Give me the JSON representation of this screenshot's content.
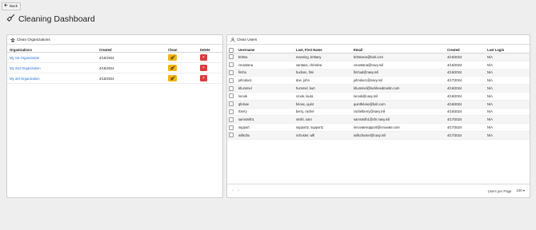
{
  "back_label": "Back",
  "title": "Cleaning Dashboard",
  "orgs_panel": {
    "title": "Clean Organizations",
    "headers": {
      "org": "Organizations",
      "created": "Created",
      "clean": "Clean",
      "delete": "Delete"
    },
    "rows": [
      {
        "name": "My 1st Organization",
        "created": "4/16/2024"
      },
      {
        "name": "My 2nd Organization",
        "created": "4/16/2024"
      },
      {
        "name": "My 3rd Organization",
        "created": "4/16/2024"
      }
    ],
    "delete_glyph": "×"
  },
  "users_panel": {
    "title": "Clean Users",
    "headers": {
      "username": "Username",
      "name": "Last, First Name",
      "email": "Email",
      "created": "Created",
      "last_login": "Last Login"
    },
    "rows": [
      {
        "username": "brittna",
        "name": "manning, brittany",
        "email": "brittmann@bah.com",
        "created": "4/16/2024",
        "last_login": "N/A"
      },
      {
        "username": "cmantana",
        "name": "santana, christina",
        "email": "cmantana@navy.mil",
        "created": "4/16/2024",
        "last_login": "N/A"
      },
      {
        "username": "fimhu",
        "name": "hudson, fimi",
        "email": "fimhud@navy.mil",
        "created": "4/16/2024",
        "last_login": "N/A"
      },
      {
        "username": "johndoe1",
        "name": "doe, john",
        "email": "johndoe1@navy.mil",
        "created": "4/17/2024",
        "last_login": "N/A"
      },
      {
        "username": "khummel",
        "name": "hummel, kurt",
        "email": "khummel@lockheedmartin.com",
        "created": "4/16/2024",
        "last_login": "N/A"
      },
      {
        "username": "lorook",
        "name": "crook, laura",
        "email": "lorook@navy.mil",
        "created": "4/16/2024",
        "last_login": "N/A"
      },
      {
        "username": "qfelose",
        "name": "felose, quint",
        "email": "quintfelose@bah.com",
        "created": "4/16/2024",
        "last_login": "N/A"
      },
      {
        "username": "rberry",
        "name": "berry, rachel",
        "email": "rachelberry@navy.mil",
        "created": "4/16/2024",
        "last_login": "N/A"
      },
      {
        "username": "samsmith1",
        "name": "smith, sam",
        "email": "samsmith1@chr.navy.mil",
        "created": "4/17/2024",
        "last_login": "N/A"
      },
      {
        "username": "support",
        "name": "support2, support1",
        "email": "innovatesupport@innovate.com",
        "created": "4/17/2024",
        "last_login": "N/A"
      },
      {
        "username": "willschu",
        "name": "schuster, will",
        "email": "willschuster@navy.mil",
        "created": "4/17/2024",
        "last_login": "N/A"
      }
    ],
    "footer": {
      "prev": "‹",
      "next": "›",
      "users_per_page_label": "Users per Page",
      "users_per_page_value": "100"
    }
  },
  "colors": {
    "clean_button": "#f3b311",
    "delete_button": "#dc3b3b",
    "link": "#1c6fd1"
  }
}
